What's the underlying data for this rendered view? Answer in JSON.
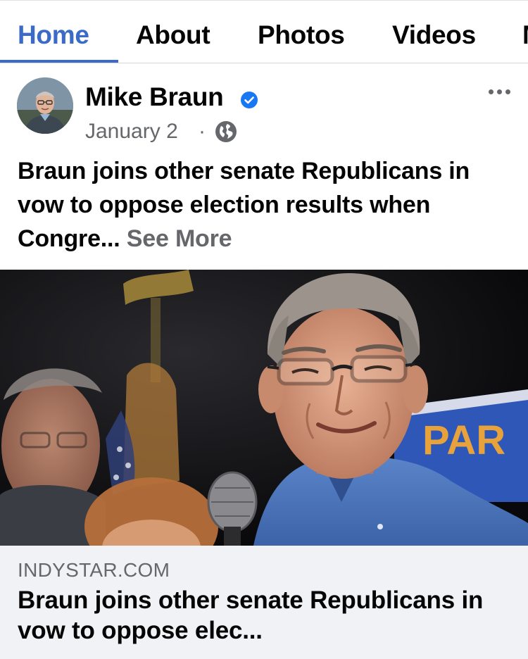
{
  "tabs": [
    {
      "label": "Home",
      "active": true
    },
    {
      "label": "About",
      "active": false
    },
    {
      "label": "Photos",
      "active": false
    },
    {
      "label": "Videos",
      "active": false
    }
  ],
  "post": {
    "author": "Mike Braun",
    "verified": true,
    "date": "January 2",
    "separator": "·",
    "privacy_icon": "globe-icon",
    "menu_icon": "more-horizontal-icon",
    "text": "Braun joins other senate Republicans in vow to oppose election results when Congre...",
    "see_more": "See More",
    "photo_banner_text": "PAR"
  },
  "link_preview": {
    "domain": "INDYSTAR.COM",
    "title": "Braun joins other senate Republicans in vow to oppose elec..."
  },
  "colors": {
    "accent": "#3b6bc7",
    "verified": "#1877f2",
    "text_primary": "#050505",
    "text_secondary": "#65676b",
    "card_background": "#f0f2f5"
  }
}
